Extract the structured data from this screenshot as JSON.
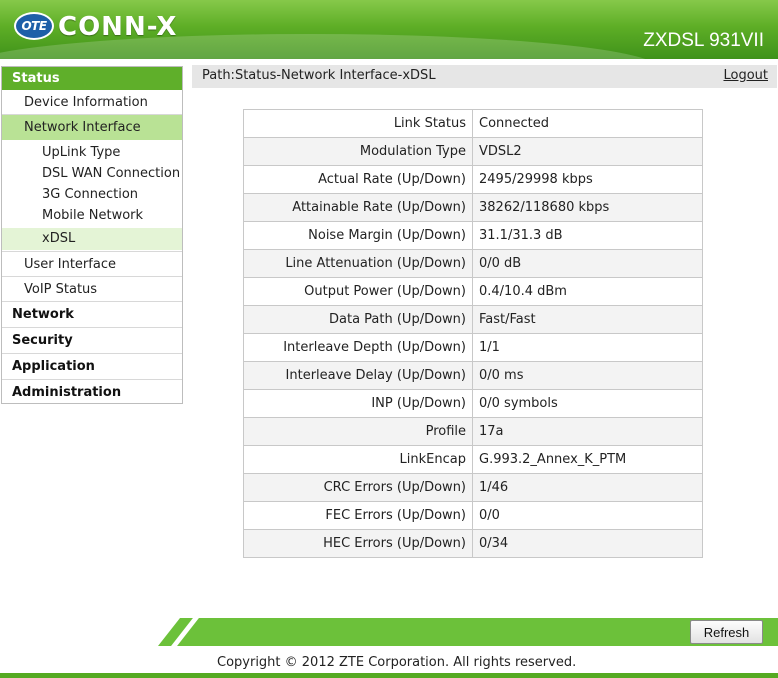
{
  "header": {
    "logo_badge": "OTE",
    "brand": "CONN-X",
    "model": "ZXDSL 931VII",
    "colors": {
      "green_dark": "#3f921a",
      "green_light": "#86c94a",
      "badge_blue": "#1e5fa8"
    }
  },
  "sidebar": {
    "status_heading": "Status",
    "device_information": "Device Information",
    "network_interface": "Network Interface",
    "sub_items": [
      "UpLink Type",
      "DSL WAN Connection",
      "3G Connection",
      "Mobile Network",
      "xDSL"
    ],
    "user_interface": "User Interface",
    "voip_status": "VoIP Status",
    "categories": [
      "Network",
      "Security",
      "Application",
      "Administration"
    ]
  },
  "path": {
    "text": "Path:Status-Network Interface-xDSL",
    "logout": "Logout"
  },
  "xdsl": {
    "rows": [
      {
        "label": "Link Status",
        "value": "Connected"
      },
      {
        "label": "Modulation Type",
        "value": "VDSL2"
      },
      {
        "label": "Actual Rate (Up/Down)",
        "value": "2495/29998 kbps"
      },
      {
        "label": "Attainable Rate (Up/Down)",
        "value": "38262/118680 kbps"
      },
      {
        "label": "Noise Margin (Up/Down)",
        "value": "31.1/31.3 dB"
      },
      {
        "label": "Line Attenuation (Up/Down)",
        "value": "0/0 dB"
      },
      {
        "label": "Output Power (Up/Down)",
        "value": "0.4/10.4 dBm"
      },
      {
        "label": "Data Path (Up/Down)",
        "value": "Fast/Fast"
      },
      {
        "label": "Interleave Depth (Up/Down)",
        "value": "1/1"
      },
      {
        "label": "Interleave Delay (Up/Down)",
        "value": "0/0 ms"
      },
      {
        "label": "INP (Up/Down)",
        "value": "0/0 symbols"
      },
      {
        "label": "Profile",
        "value": "17a"
      },
      {
        "label": "LinkEncap",
        "value": "G.993.2_Annex_K_PTM"
      },
      {
        "label": "CRC Errors (Up/Down)",
        "value": "1/46"
      },
      {
        "label": "FEC Errors (Up/Down)",
        "value": "0/0"
      },
      {
        "label": "HEC Errors (Up/Down)",
        "value": "0/34"
      }
    ]
  },
  "footer": {
    "refresh": "Refresh",
    "copyright": "Copyright © 2012 ZTE Corporation. All rights reserved."
  }
}
